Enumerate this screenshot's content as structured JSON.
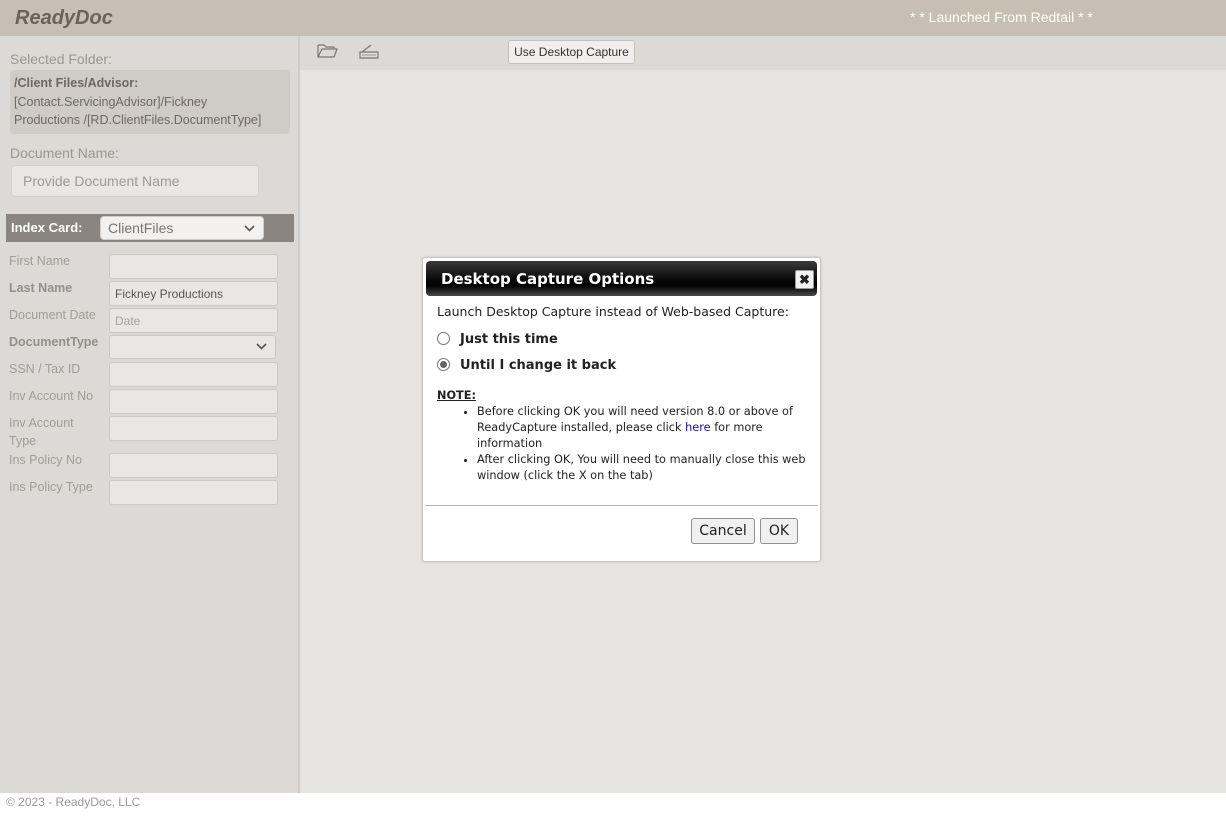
{
  "header": {
    "brand": "ReadyDoc",
    "launched_text": "* * Launched From Redtail * *"
  },
  "sidebar": {
    "selected_folder_label": "Selected Folder:",
    "folder_lines": [
      "/Client Files/Advisor:",
      "[Contact.ServicingAdvisor]/Fickney",
      "Productions /[RD.ClientFiles.DocumentType]"
    ],
    "document_name_label": "Document Name:",
    "document_name_placeholder": "Provide Document Name",
    "index_card_label": "Index Card:",
    "index_card_value": "ClientFiles",
    "fields": [
      {
        "label": "First Name",
        "value": "",
        "placeholder": ""
      },
      {
        "label": "Last Name",
        "value": "Fickney Productions",
        "placeholder": ""
      },
      {
        "label": "Document Date",
        "value": "",
        "placeholder": "Date"
      },
      {
        "label": "DocumentType",
        "value": "",
        "placeholder": ""
      },
      {
        "label": "SSN / Tax ID",
        "value": "",
        "placeholder": ""
      },
      {
        "label": "Inv Account No",
        "value": "",
        "placeholder": ""
      },
      {
        "label": "Inv Account Type",
        "value": "",
        "placeholder": ""
      },
      {
        "label": "Ins Policy No",
        "value": "",
        "placeholder": ""
      },
      {
        "label": "Ins Policy Type",
        "value": "",
        "placeholder": ""
      }
    ]
  },
  "toolbar": {
    "icons": [
      "folder-open-icon",
      "scanner-icon"
    ],
    "desktop_capture_label": "Use Desktop Capture"
  },
  "dialog": {
    "title": "Desktop Capture Options",
    "close_glyph": "✖",
    "prompt": "Launch Desktop Capture instead of Web-based Capture:",
    "options": [
      {
        "label": "Just this time",
        "checked": false
      },
      {
        "label": "Until I change it back",
        "checked": true
      }
    ],
    "note_heading": "NOTE:",
    "note1_before": "Before clicking OK you will need version 8.0 or above of ReadyCapture installed, please click ",
    "note1_link": "here",
    "note1_after": " for more information",
    "note2": "After clicking OK, You will need to manually close this web window (click the X on the tab)",
    "cancel_label": "Cancel",
    "ok_label": "OK"
  },
  "footer": {
    "copyright": "© 2023 - ReadyDoc, LLC"
  }
}
